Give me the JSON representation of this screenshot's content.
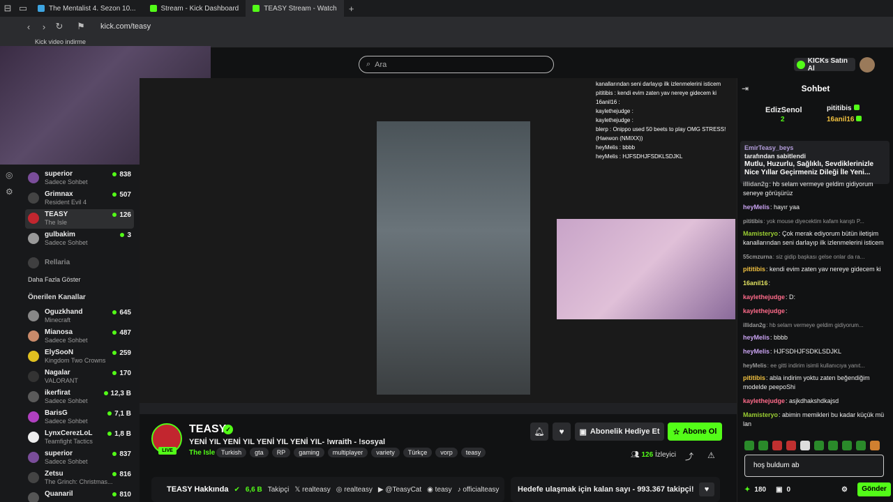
{
  "browser": {
    "tabs": [
      {
        "label": "The Mentalist 4. Sezon 10..."
      },
      {
        "label": "Stream - Kick Dashboard"
      },
      {
        "label": "TEASY Stream - Watch",
        "active": true
      }
    ],
    "url": "kick.com/teasy",
    "bookmark": "Kick video indirme"
  },
  "search": {
    "placeholder": "Ara"
  },
  "header": {
    "kicks_label": "KICKs Satın Al"
  },
  "sidebar": {
    "following": [
      {
        "name": "superior",
        "sub": "Sadece Sohbet",
        "count": "838"
      },
      {
        "name": "Grimnax",
        "sub": "Resident Evil 4",
        "count": "507"
      },
      {
        "name": "TEASY",
        "sub": "The Isle",
        "count": "126",
        "active": true
      },
      {
        "name": "gulbakim",
        "sub": "Sadece Sohbet",
        "count": "3"
      },
      {
        "name": "Rellaria",
        "sub": "",
        "count": ""
      }
    ],
    "show_more": "Daha Fazla Göster",
    "recommended_title": "Önerilen Kanallar",
    "recommended": [
      {
        "name": "Oguzkhand",
        "sub": "Minecraft",
        "count": "645"
      },
      {
        "name": "Mianosa",
        "sub": "Sadece Sohbet",
        "count": "487"
      },
      {
        "name": "ElySooN",
        "sub": "Kingdom Two Crowns",
        "count": "259"
      },
      {
        "name": "Nagalar",
        "sub": "VALORANT",
        "count": "170"
      },
      {
        "name": "ikerfirat",
        "sub": "Sadece Sohbet",
        "count": "12,3 B"
      },
      {
        "name": "BarisG",
        "sub": "Sadece Sohbet",
        "count": "7,1 B"
      },
      {
        "name": "LynxCerezLoL",
        "sub": "Teamfight Tactics",
        "count": "1,8 B"
      },
      {
        "name": "superior",
        "sub": "Sadece Sohbet",
        "count": "837"
      },
      {
        "name": "Zetsu",
        "sub": "The Grinch: Christmas...",
        "count": "816"
      },
      {
        "name": "Quanaril",
        "sub": "",
        "count": "810"
      }
    ]
  },
  "overlay_chat": [
    "kanallarından seni darlayıp ilk izlenmelerini isticem",
    "pititibis : kendi evim zaten yav nereye gidecem ki",
    "16anil16 :",
    "kaylethejudge :",
    "kaylethejudge :",
    "blerp : Onippo used 50 beets to play OMG STRESS! (Haewon (NMIXX))",
    "heyMelis : bbbb",
    "heyMelis : HJFSDHJFSDKLSDJKL"
  ],
  "stream": {
    "channel": "TEASY",
    "live": "LIVE",
    "title": "YENİ YIL YENİ YIL YENİ YIL YENİ YIL- !wraith - !sosyal",
    "category": "The Isle",
    "tags": [
      "Turkish",
      "gta",
      "RP",
      "gaming",
      "multiplayer",
      "variety",
      "Türkçe",
      "vorp",
      "teasy"
    ],
    "gift_label": "Abonelik Hediye Et",
    "subscribe_label": "Abone Ol",
    "viewers": "126",
    "viewers_label": "İzleyici"
  },
  "about": {
    "title": "TEASY Hakkında",
    "followers": "6,6 B",
    "followers_label": "Takipçi",
    "socials": [
      "realteasy",
      "realteasy",
      "@TeasyCat",
      "teasy",
      "officialteasy"
    ]
  },
  "goal": {
    "text": "Hedefe ulaşmak için kalan sayı - 993.367 takipçi!"
  },
  "chat": {
    "title": "Sohbet",
    "gifters": [
      {
        "name": "EdizSenol",
        "count": "2"
      },
      {
        "name": "pititibis",
        "count": ""
      },
      {
        "name": "16anil16",
        "count": ""
      }
    ],
    "pinned_user": "EmirTeasy_beys",
    "pinned_by": "tarafından sabitlendi",
    "pinned_msg": "Mutlu, Huzurlu, Sağlıklı, Sevdiklerinizle Nice Yıllar Geçirmeniz Dileği İle Yeni...",
    "messages": [
      {
        "user": "illidan2g",
        "text": ": hb selam vermeye geldim gidiyorum seneye görüşürüz",
        "color": "#b0b0b0"
      },
      {
        "user": "heyMelis",
        "text": ": hayır yaa",
        "color": "#c8a2f0"
      },
      {
        "user": "pititibis",
        "text": ": yok mouse diyecektim kafam karıştı P...",
        "system": true
      },
      {
        "user": "Mamisteryo",
        "text": ": Çok merak ediyorum bütün iletişim kanallarından seni darlayıp ilk izlenmelerini isticem",
        "color": "#9acd32"
      },
      {
        "user": "55cmzurna",
        "text": ": siz gidip başkası gelse onlar da ra...",
        "system": true
      },
      {
        "user": "pititibis",
        "text": ": kendi evim zaten yav nereye gidecem ki",
        "color": "#f0c040"
      },
      {
        "user": "16anil16",
        "text": ":",
        "color": "#e0e060"
      },
      {
        "user": "kaylethejudge",
        "text": ": D:",
        "color": "#ff6b8a"
      },
      {
        "user": "kaylethejudge",
        "text": ":",
        "color": "#ff6b8a"
      },
      {
        "user": "illidan2g",
        "text": ": hb selam vermeye geldim gidiyorum...",
        "system": true
      },
      {
        "user": "heyMelis",
        "text": ": bbbb",
        "color": "#c8a2f0"
      },
      {
        "user": "heyMelis",
        "text": ": HJFSDHJFSDKLSDJKL",
        "color": "#c8a2f0"
      },
      {
        "user": "heyMelis",
        "text": ": ee gitti indirim isimli kullanıcıya yanıt...",
        "system": true
      },
      {
        "user": "pititibis",
        "text": ": abla indirim yoktu zaten beğendiğim modelde peepoShi",
        "color": "#f0c040"
      },
      {
        "user": "kaylethejudge",
        "text": ": asjkdhakshdkajsd",
        "color": "#ff6b8a"
      },
      {
        "user": "Mamisteryo",
        "text": ": abimin memikleri bu kadar küçük mü lan",
        "color": "#9acd32"
      }
    ],
    "input_value": "hoş buldum ab",
    "points": "180",
    "gifts": "0",
    "send_label": "Gönder"
  }
}
